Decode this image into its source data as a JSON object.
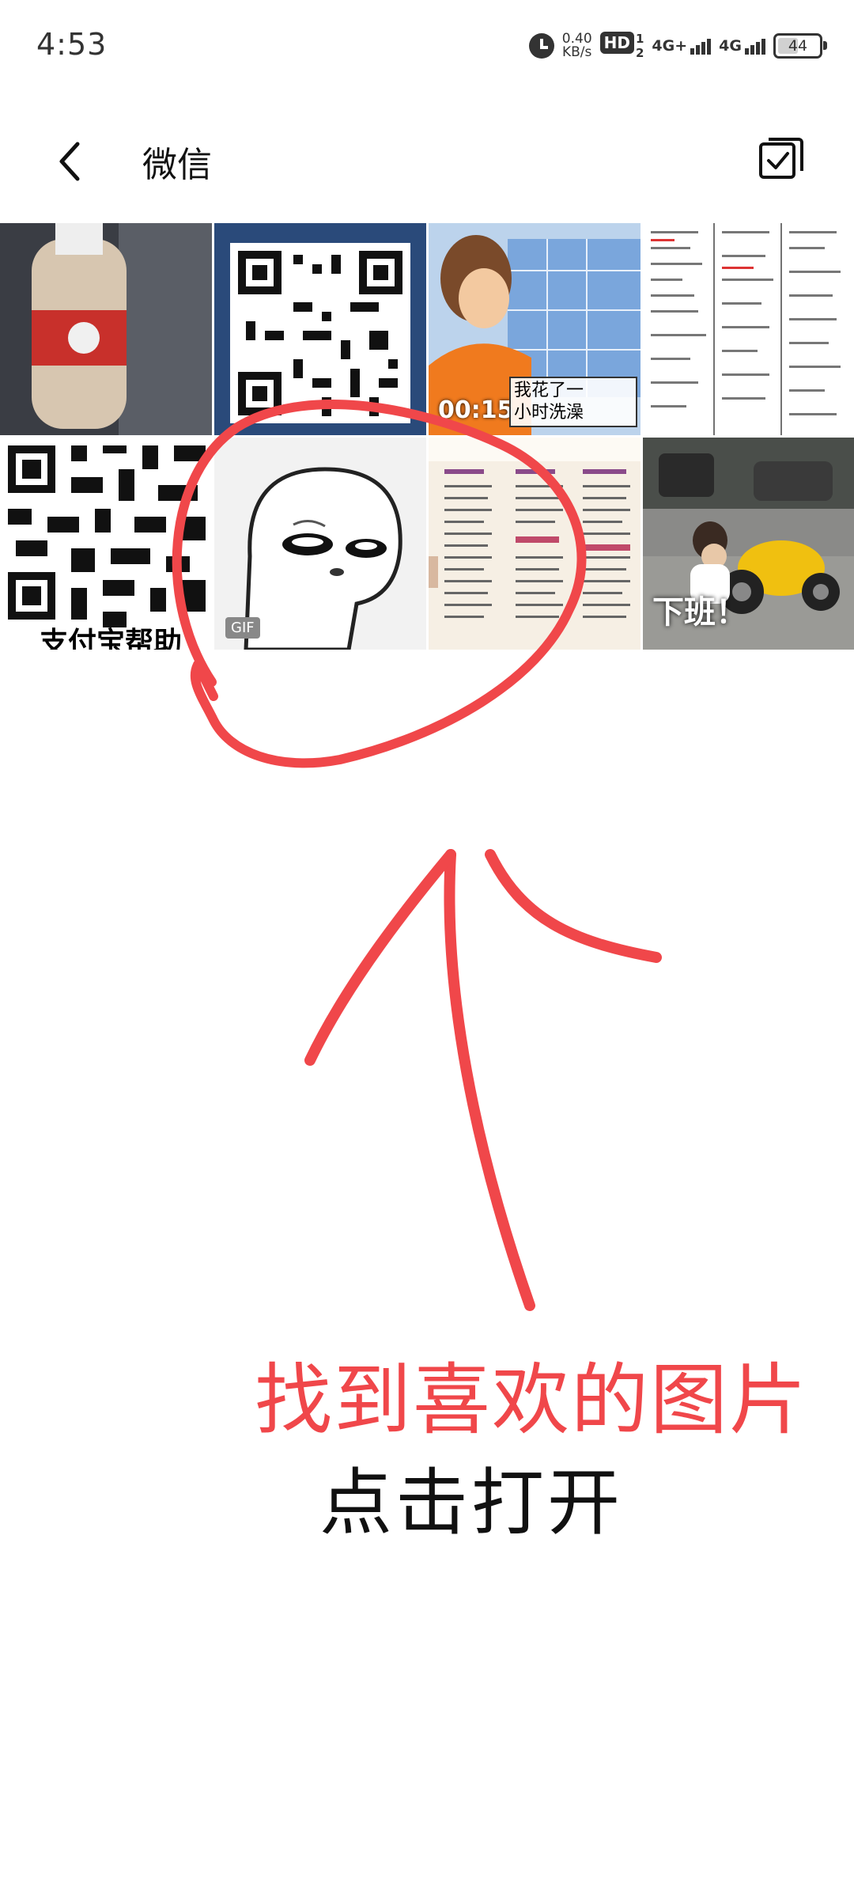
{
  "status_bar": {
    "time": "4:53",
    "net_speed_value": "0.40",
    "net_speed_unit": "KB/s",
    "hd_label": "HD",
    "hd_sub": "1\n2",
    "sim1_label": "4G+",
    "sim2_label": "4G",
    "battery": "44"
  },
  "header": {
    "title": "微信",
    "back_icon": "chevron-left-icon",
    "select_icon": "multi-select-icon"
  },
  "grid": {
    "tiles": [
      {
        "name": "water-bottle-photo"
      },
      {
        "name": "qr-code-photo"
      },
      {
        "name": "video-cartoon",
        "duration": "00:15",
        "sticker_text": "我花了一\n小时洗澡"
      },
      {
        "name": "document-screenshot"
      },
      {
        "name": "qr-code-2",
        "partial_caption": "支付宝帮助"
      },
      {
        "name": "gif-meme",
        "badge": "GIF"
      },
      {
        "name": "menu-photo"
      },
      {
        "name": "kid-motorbike-photo",
        "caption": "下班！"
      }
    ]
  },
  "annotation": {
    "instruction_line1": "找到喜欢的图片",
    "instruction_line2": "点击打开",
    "accent_color": "#f0474a"
  }
}
